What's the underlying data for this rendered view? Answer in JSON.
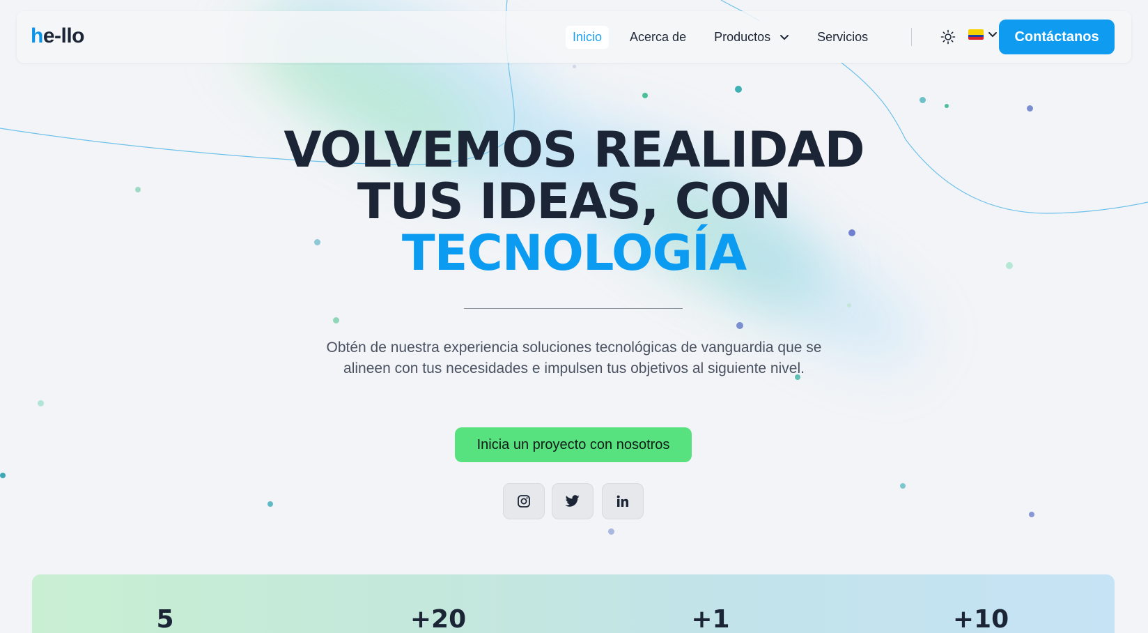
{
  "header": {
    "logo_prefix": "h",
    "logo_rest": "e-llo",
    "nav": [
      {
        "label": "Inicio",
        "active": true
      },
      {
        "label": "Acerca de"
      },
      {
        "label": "Productos",
        "has_dropdown": true
      },
      {
        "label": "Servicios"
      }
    ],
    "theme_icon": "sun-icon",
    "language_flag": "ecuador-flag",
    "contact_label": "Contáctanos"
  },
  "hero": {
    "title_line1": "VOLVEMOS REALIDAD",
    "title_line2": "TUS IDEAS, CON",
    "title_accent": "TECNOLOGÍA",
    "subtitle": "Obtén de nuestra experiencia soluciones tecnológicas de vanguardia que se alineen con tus necesidades e impulsen tus objetivos al siguiente nivel.",
    "cta_label": "Inicia un proyecto con nosotros",
    "social": [
      "instagram-icon",
      "twitter-icon",
      "linkedin-icon"
    ]
  },
  "stats": {
    "values": [
      "5",
      "+20",
      "+1",
      "+10"
    ]
  },
  "colors": {
    "accent": "#0b9cf2",
    "cta": "#57e27f",
    "text": "#1c2536",
    "background": "#f2f4f7"
  }
}
